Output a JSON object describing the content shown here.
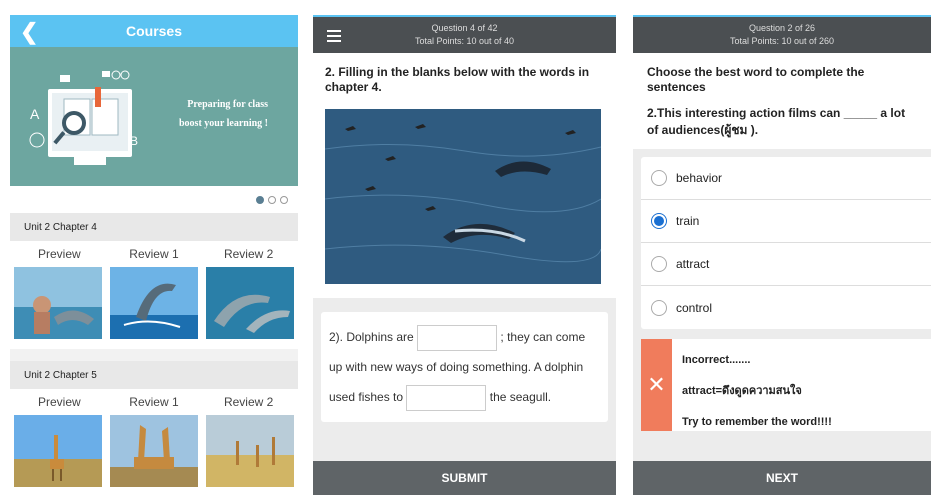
{
  "courses": {
    "title": "Courses",
    "banner": {
      "line1": "Preparing for class",
      "line2": "boost your learning !"
    },
    "units": [
      {
        "title": "Unit 2 Chapter 4",
        "items": [
          "Preview",
          "Review 1",
          "Review 2"
        ]
      },
      {
        "title": "Unit 2 Chapter 5",
        "items": [
          "Preview",
          "Review 1",
          "Review 2"
        ]
      }
    ]
  },
  "quiz1": {
    "question_progress": "Question 4 of 42",
    "points": "Total Points: 10 out of 40",
    "prompt": "2. Filling in the blanks below with the words in chapter 4.",
    "sentence": {
      "part1": "2). Dolphins are",
      "part2": "; they can come up with new ways of doing something. A dolphin used fishes to",
      "part3": "the seagull."
    },
    "submit_label": "SUBMIT"
  },
  "quiz2": {
    "question_progress": "Question 2 of 26",
    "points": "Total Points: 10 out of 260",
    "instruction": "Choose the best word to complete the sentences",
    "question": "2.This interesting action films can _____ a lot of audiences(ผู้ชม ).",
    "options": [
      "behavior",
      "train",
      "attract",
      "control"
    ],
    "selected": "train",
    "feedback": {
      "status": "Incorrect.......",
      "answer": "attract=ดึงดูดความสนใจ",
      "tip": "Try to remember the word!!!!"
    },
    "next_label": "NEXT"
  },
  "colors": {
    "header": "#5bc3f2",
    "bar": "#4b4f52",
    "error": "#f07c5c",
    "selected": "#1a6fd1"
  }
}
